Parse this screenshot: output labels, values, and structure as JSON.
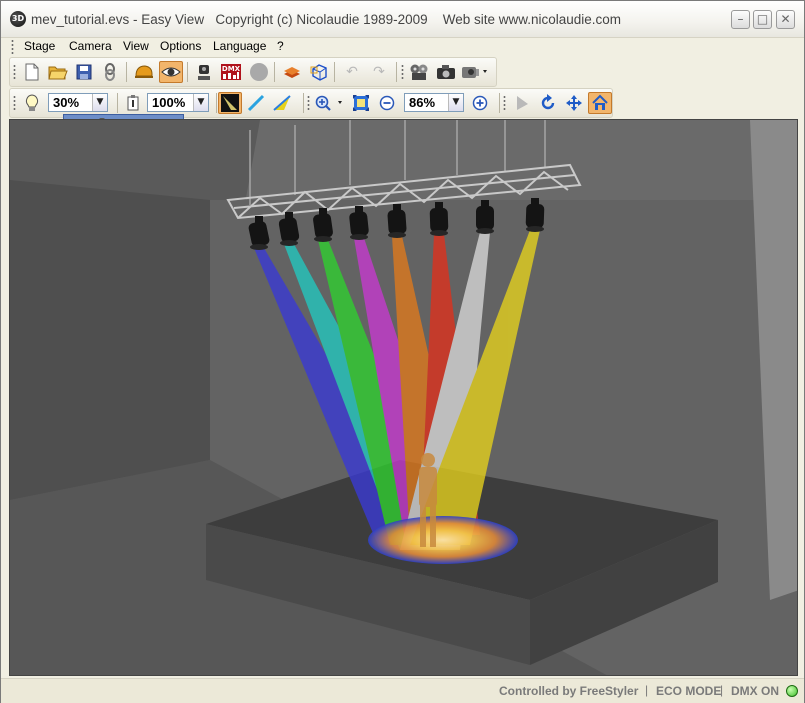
{
  "window": {
    "title": "mev_tutorial.evs - Easy View   Copyright (c) Nicolaudie 1989-2009    Web site www.nicolaudie.com",
    "app_icon_text": "3D",
    "controls": {
      "minimize": "–",
      "maximize": "□",
      "close": "✕"
    }
  },
  "menu": {
    "items": [
      "Stage",
      "Camera",
      "View",
      "Options",
      "Language",
      "?"
    ]
  },
  "toolbar_top": {
    "icons": [
      "new-file-icon",
      "open-folder-icon",
      "save-icon",
      "link-icon",
      "helmet-icon",
      "eye-icon",
      "moving-head-icon",
      "dmx-icon",
      "circle-icon",
      "stack-icon",
      "cube-icon",
      "undo-icon",
      "redo-icon",
      "film-icon",
      "camera-icon",
      "projector-icon"
    ],
    "dmx_label": "DMX"
  },
  "toolbar_bottom": {
    "light_level": "30%",
    "beam_level": "100%",
    "zoom_level": "86%"
  },
  "slider": {
    "value": 0.3
  },
  "status": {
    "controlled_by": "Controlled by FreeStyler",
    "eco_mode": "ECO MODE",
    "dmx_state": "DMX ON",
    "separator": "|",
    "led_color": "#3fbf2a"
  },
  "beams": {
    "colors": [
      "#3a3ad6",
      "#22c9c0",
      "#2fd12f",
      "#c83ad0",
      "#e07a1c",
      "#e0301c",
      "#d8d8d8",
      "#e6d21c"
    ]
  }
}
